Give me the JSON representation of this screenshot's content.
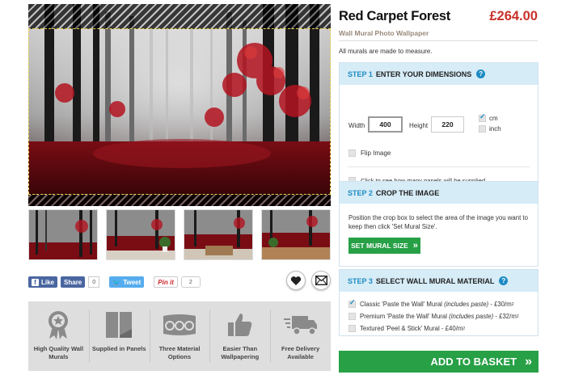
{
  "product": {
    "title": "Red Carpet Forest",
    "price": "£264.00",
    "subtitle": "Wall Mural Photo Wallpaper",
    "note": "All murals are made to measure."
  },
  "social": {
    "facebook_label": "Like",
    "share_label": "Share",
    "share_count": "0",
    "tweet_label": "Tweet",
    "pinit_label": "Pin it",
    "pin_count": "2"
  },
  "features": [
    {
      "label": "High Quality Wall Murals",
      "icon": "award-ribbon-icon"
    },
    {
      "label": "Supplied in Panels",
      "icon": "panels-icon"
    },
    {
      "label": "Three Material Options",
      "icon": "material-rolls-icon"
    },
    {
      "label": "Easier Than Wallpapering",
      "icon": "thumbs-up-icon"
    },
    {
      "label": "Free Delivery Available",
      "icon": "delivery-truck-icon"
    }
  ],
  "step1": {
    "step": "STEP 1",
    "title": "ENTER YOUR DIMENSIONS",
    "width_label": "Width",
    "width_value": "400",
    "height_label": "Height",
    "height_value": "220",
    "unit_cm": "cm",
    "unit_inch": "inch",
    "flip_label": "Flip Image",
    "panels_label": "Click to see how many panels will be supplied"
  },
  "step2": {
    "step": "STEP 2",
    "title": "CROP THE IMAGE",
    "text": "Position the crop box to select the area of the image you want to keep then click 'Set Mural Size'.",
    "button": "SET MURAL SIZE",
    "button_arrow": "»"
  },
  "step3": {
    "step": "STEP 3",
    "title": "SELECT WALL MURAL MATERIAL",
    "options": [
      {
        "name": "Classic 'Paste the Wall' Mural",
        "note": "(includes paste)",
        "price": "- £30/m",
        "checked": true
      },
      {
        "name": "Premium 'Paste the Wall' Mural",
        "note": "(includes paste)",
        "price": "- £32/m",
        "checked": false
      },
      {
        "name": "Textured 'Peel & Stick' Mural",
        "note": "",
        "price": "- £40/m",
        "checked": false
      }
    ],
    "unit_sup": "2"
  },
  "basket": {
    "label": "ADD TO BASKET",
    "arrow": "»"
  },
  "colors": {
    "accent_blue": "#1e8bc3",
    "price_red": "#c8322a",
    "button_green": "#27a046",
    "panel_header": "#d6ecf7"
  }
}
